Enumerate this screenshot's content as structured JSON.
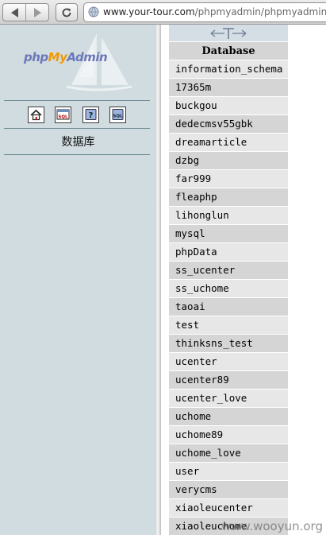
{
  "browser": {
    "url_host": "www.your-tour.com",
    "url_path": "/phpmyadmin/phpmyadmin/"
  },
  "nav": {
    "logo_part1": "php",
    "logo_part2": "My",
    "logo_part3": "Admin",
    "icons": [
      "home-icon",
      "sql-icon",
      "help-icon",
      "docs-icon"
    ],
    "title": "数据库"
  },
  "main": {
    "column_header": "Database",
    "databases": [
      "information_schema",
      "17365m",
      "buckgou",
      "dedecmsv55gbk",
      "dreamarticle",
      "dzbg",
      "far999",
      "fleaphp",
      "lihonglun",
      "mysql",
      "phpData",
      "ss_ucenter",
      "ss_uchome",
      "taoai",
      "test",
      "thinksns_test",
      "ucenter",
      "ucenter89",
      "ucenter_love",
      "uchome",
      "uchome89",
      "uchome_love",
      "user",
      "verycms",
      "xiaoleucenter",
      "xiaoleuchome"
    ]
  },
  "watermark": "www.wooyun.org",
  "colors": {
    "nav_bg": "#d0dce0",
    "row_odd": "#e7e7e7",
    "row_even": "#d5d5d5",
    "logo_blue": "#6c78b8",
    "logo_orange": "#f29700"
  }
}
